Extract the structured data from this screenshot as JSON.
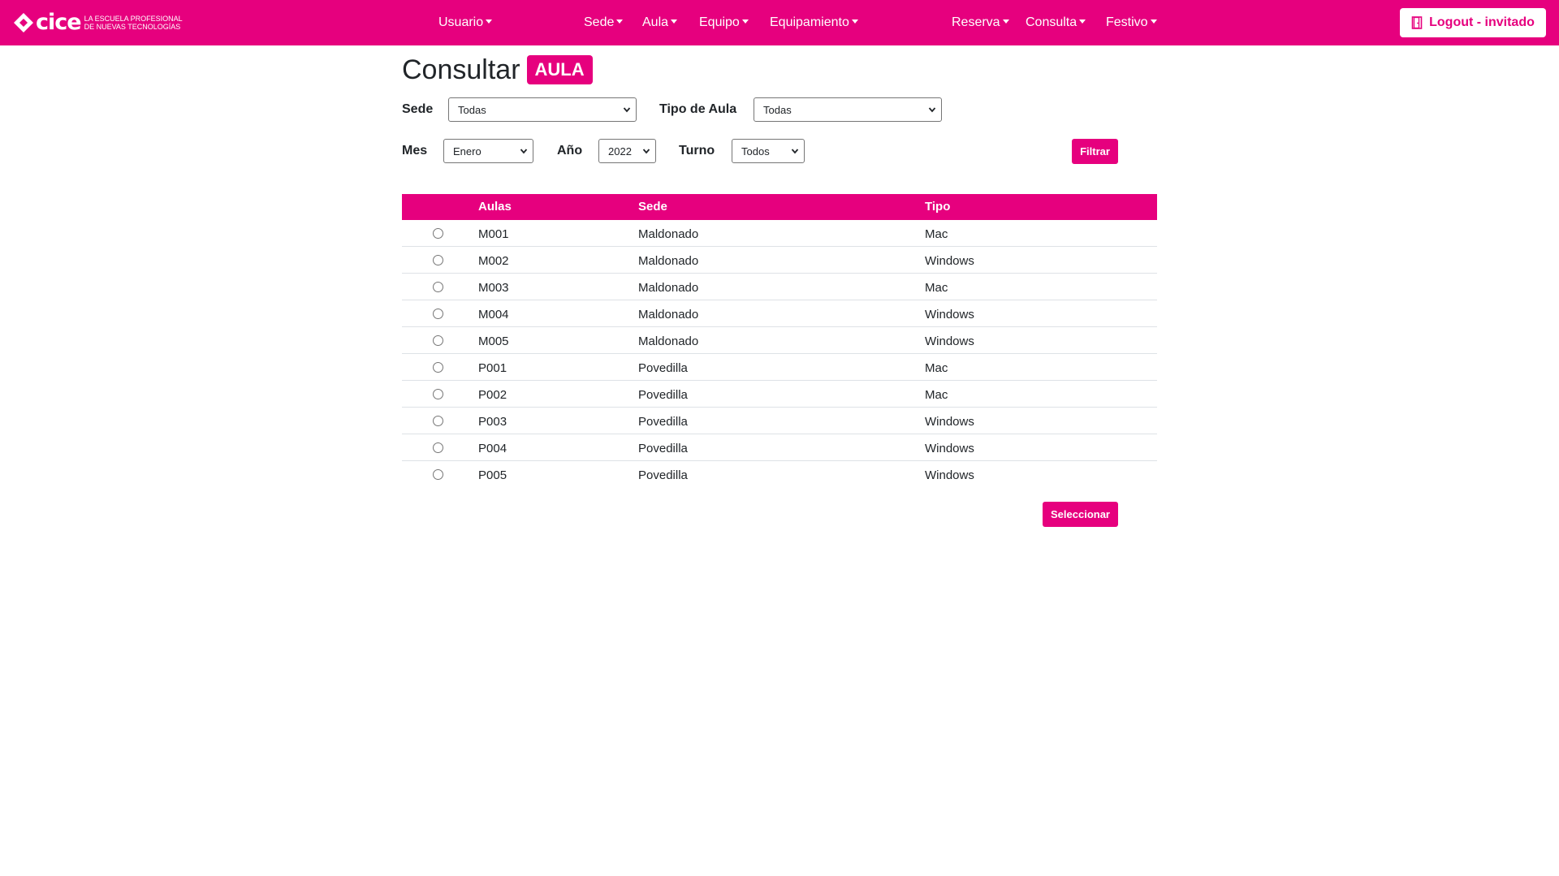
{
  "brand": {
    "name": "cice",
    "tagline_line1": "La escuela profesional",
    "tagline_line2": "de nuevas tecnologías"
  },
  "nav": {
    "usuario": "Usuario",
    "sede": "Sede",
    "aula": "Aula",
    "equipo": "Equipo",
    "equipamiento": "Equipamiento",
    "reserva": "Reserva",
    "consulta": "Consulta",
    "festivo": "Festivo",
    "logout": "Logout - invitado"
  },
  "page": {
    "title": "Consultar",
    "badge": "AULA"
  },
  "filters": {
    "sede_label": "Sede",
    "sede_value": "Todas",
    "tipo_label": "Tipo de Aula",
    "tipo_value": "Todas",
    "mes_label": "Mes",
    "mes_value": "Enero",
    "anio_label": "Año",
    "anio_value": "2022",
    "turno_label": "Turno",
    "turno_value": "Todos",
    "filtrar_label": "Filtrar"
  },
  "table": {
    "headers": {
      "aulas": "Aulas",
      "sede": "Sede",
      "tipo": "Tipo"
    },
    "rows": [
      {
        "aula": "M001",
        "sede": "Maldonado",
        "tipo": "Mac"
      },
      {
        "aula": "M002",
        "sede": "Maldonado",
        "tipo": "Windows"
      },
      {
        "aula": "M003",
        "sede": "Maldonado",
        "tipo": "Mac"
      },
      {
        "aula": "M004",
        "sede": "Maldonado",
        "tipo": "Windows"
      },
      {
        "aula": "M005",
        "sede": "Maldonado",
        "tipo": "Windows"
      },
      {
        "aula": "P001",
        "sede": "Povedilla",
        "tipo": "Mac"
      },
      {
        "aula": "P002",
        "sede": "Povedilla",
        "tipo": "Mac"
      },
      {
        "aula": "P003",
        "sede": "Povedilla",
        "tipo": "Windows"
      },
      {
        "aula": "P004",
        "sede": "Povedilla",
        "tipo": "Windows"
      },
      {
        "aula": "P005",
        "sede": "Povedilla",
        "tipo": "Windows"
      }
    ]
  },
  "actions": {
    "seleccionar_label": "Seleccionar"
  },
  "colors": {
    "accent": "#e6007e",
    "row_border": "#dee2e6"
  }
}
